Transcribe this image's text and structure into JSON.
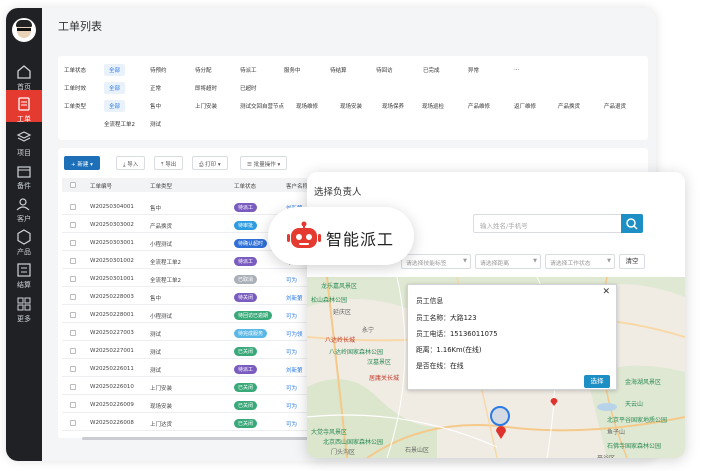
{
  "sidebar": {
    "items": [
      {
        "label": "首页",
        "icon": "home-icon"
      },
      {
        "label": "工单",
        "icon": "work-order-icon",
        "active": true
      },
      {
        "label": "项目",
        "icon": "layers-icon"
      },
      {
        "label": "备件",
        "icon": "box-icon"
      },
      {
        "label": "客户",
        "icon": "users-icon"
      },
      {
        "label": "产品",
        "icon": "cube-icon"
      },
      {
        "label": "结算",
        "icon": "settle-icon"
      },
      {
        "label": "更多",
        "icon": "grid-icon"
      }
    ],
    "active_color": "#e53a30"
  },
  "page": {
    "title": "工单列表"
  },
  "filters": {
    "rows": [
      {
        "label": "工单状态",
        "options": [
          "全部",
          "待预约",
          "待分配",
          "待派工",
          "服务中",
          "待结算",
          "待回访",
          "已完成",
          "异常",
          "..."
        ]
      },
      {
        "label": "工单时效",
        "options": [
          "全部",
          "正常",
          "即将超时",
          "已超时"
        ]
      },
      {
        "label": "工单类型",
        "options": [
          "全部",
          "售中",
          "上门安装",
          "测试交回自营节点",
          "现场维修",
          "现场安装",
          "现场保养",
          "现场巡检",
          "产品维修",
          "返厂维修",
          "产品换货",
          "产品退货"
        ]
      },
      {
        "label": "",
        "options": [
          "全流程工单2",
          "测试"
        ]
      }
    ]
  },
  "toolbar": {
    "new_label": "新建",
    "import_label": "导入",
    "export_label": "导出",
    "print_label": "打印",
    "batch_label": "批量操作"
  },
  "table": {
    "headers": [
      "工单编号",
      "工单类型",
      "工单状态",
      "客户名称"
    ],
    "rows": [
      {
        "id": "W20250304001",
        "type": "售中",
        "status": "待派工",
        "status_color": "#7a5cc0",
        "customer": "刘新第"
      },
      {
        "id": "W20250303002",
        "type": "产品换货",
        "status": "待审批",
        "status_color": "#2c9be0",
        "customer": "刘新第"
      },
      {
        "id": "W20250303001",
        "type": "小程测试",
        "status": "待确认超时",
        "status_color": "#2f6fd6",
        "customer": "刘新第"
      },
      {
        "id": "W20250301002",
        "type": "全流程工单2",
        "status": "待派工",
        "status_color": "#7a5cc0",
        "customer": "可为"
      },
      {
        "id": "W20250301001",
        "type": "全流程工单2",
        "status": "已取消",
        "status_color": "#aab0b8",
        "customer": "可为"
      },
      {
        "id": "W20250228003",
        "type": "售中",
        "status": "待关闭",
        "status_color": "#7a5cc0",
        "customer": "刘新第"
      },
      {
        "id": "W20250228001",
        "type": "小程测试",
        "status": "待回访已逾期",
        "status_color": "#3aa97a",
        "customer": "可为"
      },
      {
        "id": "W20250227003",
        "type": "测试",
        "status": "待完成服务",
        "status_color": "#5bb8e6",
        "customer": "可为领"
      },
      {
        "id": "W20250227001",
        "type": "测试",
        "status": "已关闭",
        "status_color": "#3aa97a",
        "customer": "可为"
      },
      {
        "id": "W20250226011",
        "type": "测试",
        "status": "待派工",
        "status_color": "#7a5cc0",
        "customer": "刘新第"
      },
      {
        "id": "W20250226010",
        "type": "上门安装",
        "status": "已关闭",
        "status_color": "#3aa97a",
        "customer": "可为"
      },
      {
        "id": "W20250226009",
        "type": "现场安装",
        "status": "已关闭",
        "status_color": "#3aa97a",
        "customer": "可为"
      },
      {
        "id": "W20250226008",
        "type": "上门达货",
        "status": "已关闭",
        "status_color": "#3aa97a",
        "customer": "可为"
      }
    ]
  },
  "ai_badge": {
    "label": "智能派工"
  },
  "modal": {
    "title": "选择负责人",
    "search_placeholder": "输入姓名/手机号",
    "filters": [
      "请选择技能标签",
      "请选择距离",
      "请选择工作状态"
    ],
    "clear_label": "清空",
    "info_window": {
      "title": "员工信息",
      "name": "员工名称：大路123",
      "phone": "员工电话：15136011075",
      "distance": "距离：1.16Km(在线)",
      "online": "是否在线：在线",
      "choose_label": "选择"
    },
    "map_labels": [
      {
        "text": "龙乐嘉风景区",
        "color": "green"
      },
      {
        "text": "松山森林公园",
        "color": "green"
      },
      {
        "text": "延庆区",
        "color": "gray"
      },
      {
        "text": "永宁",
        "color": "gray"
      },
      {
        "text": "八达岭长城",
        "color": "red"
      },
      {
        "text": "八达岭国家森林公园",
        "color": "green"
      },
      {
        "text": "汉墓景区",
        "color": "green"
      },
      {
        "text": "居庸关长城",
        "color": "red"
      },
      {
        "text": "大觉寺风景区",
        "color": "green"
      },
      {
        "text": "北京西山国家森林公园",
        "color": "green"
      },
      {
        "text": "门头沟区",
        "color": "gray"
      },
      {
        "text": "石景山区",
        "color": "gray"
      },
      {
        "text": "平谷区",
        "color": "gray"
      },
      {
        "text": "天云山",
        "color": "green"
      },
      {
        "text": "金海湖风景区",
        "color": "green"
      },
      {
        "text": "北京平谷国家地质公园",
        "color": "green"
      },
      {
        "text": "鱼子山",
        "color": "gray"
      },
      {
        "text": "石佛寺国家森林公园",
        "color": "green"
      }
    ]
  }
}
